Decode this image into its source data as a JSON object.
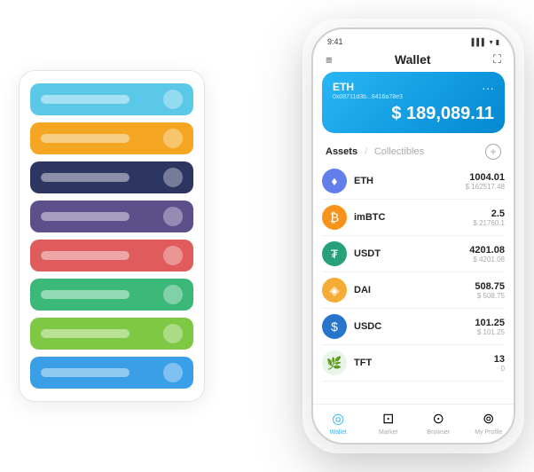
{
  "scene": {
    "cards": [
      {
        "color": "#5bc8e8",
        "label": "",
        "id": "card-blue-light"
      },
      {
        "color": "#f5a623",
        "label": "",
        "id": "card-orange"
      },
      {
        "color": "#2d3561",
        "label": "",
        "id": "card-dark-navy"
      },
      {
        "color": "#5c4f8a",
        "label": "",
        "id": "card-purple"
      },
      {
        "color": "#e05c5c",
        "label": "",
        "id": "card-red"
      },
      {
        "color": "#3cb878",
        "label": "",
        "id": "card-green"
      },
      {
        "color": "#7ec843",
        "label": "",
        "id": "card-light-green"
      },
      {
        "color": "#3b9fe8",
        "label": "",
        "id": "card-blue"
      }
    ]
  },
  "phone": {
    "status_time": "9:41",
    "title": "Wallet",
    "wallet": {
      "coin": "ETH",
      "address": "0x08711d3b...8416a78e3",
      "amount": "$ 189,089.11",
      "more_icon": "···"
    },
    "assets_tab": "Assets",
    "collectibles_tab": "Collectibles",
    "add_icon": "+",
    "assets": [
      {
        "name": "ETH",
        "amount": "1004.01",
        "usd": "$ 162517.48",
        "icon": "♦",
        "icon_bg": "#627EEA",
        "icon_color": "#fff"
      },
      {
        "name": "imBTC",
        "amount": "2.5",
        "usd": "$ 21760.1",
        "icon": "₿",
        "icon_bg": "#F7931A",
        "icon_color": "#fff"
      },
      {
        "name": "USDT",
        "amount": "4201.08",
        "usd": "$ 4201.08",
        "icon": "₮",
        "icon_bg": "#26A17B",
        "icon_color": "#fff"
      },
      {
        "name": "DAI",
        "amount": "508.75",
        "usd": "$ 508.75",
        "icon": "◈",
        "icon_bg": "#F5AC37",
        "icon_color": "#fff"
      },
      {
        "name": "USDC",
        "amount": "101.25",
        "usd": "$ 101.25",
        "icon": "$",
        "icon_bg": "#2775CA",
        "icon_color": "#fff"
      },
      {
        "name": "TFT",
        "amount": "13",
        "usd": "0",
        "icon": "🌿",
        "icon_bg": "#e8f5e9",
        "icon_color": "#388e3c"
      }
    ],
    "nav": [
      {
        "label": "Wallet",
        "icon": "◉",
        "active": true
      },
      {
        "label": "Market",
        "icon": "📈",
        "active": false
      },
      {
        "label": "Browser",
        "icon": "👤",
        "active": false
      },
      {
        "label": "My Profile",
        "icon": "👤",
        "active": false
      }
    ]
  }
}
